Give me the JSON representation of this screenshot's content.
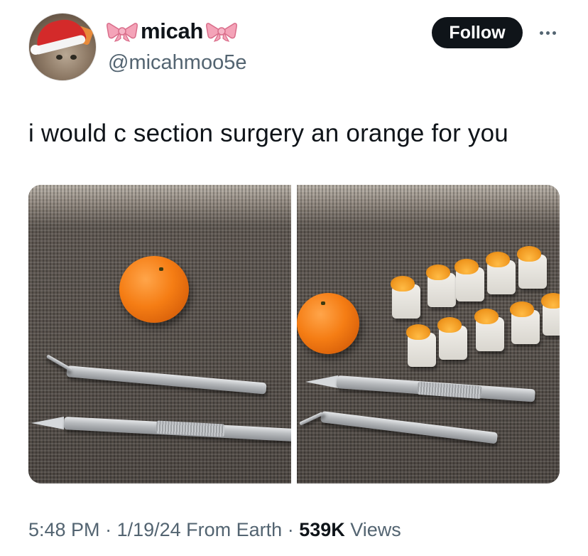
{
  "author": {
    "display_name": "micah",
    "handle": "@micahmoo5e",
    "avatar_icon": "cat-with-santa-hat-avatar",
    "name_decoration_icon": "pink-bow-emoji"
  },
  "actions": {
    "follow_label": "Follow",
    "more_icon": "more-horizontal-icon"
  },
  "tweet": {
    "text": "i would c section surgery an orange for you"
  },
  "media": {
    "photos": [
      {
        "subject": "whole-orange-with-tweezers-and-scalpel"
      },
      {
        "subject": "peeled-orange-segments-with-tools"
      }
    ]
  },
  "meta": {
    "time": "5:48 PM",
    "sep1": " · ",
    "date": "1/19/24",
    "source": " From Earth",
    "sep2": " · ",
    "views_count": "539K",
    "views_label": " Views"
  },
  "colors": {
    "text_primary": "#0f1419",
    "text_secondary": "#536471",
    "follow_bg": "#0f1419",
    "bow": "#f4a3b8"
  }
}
